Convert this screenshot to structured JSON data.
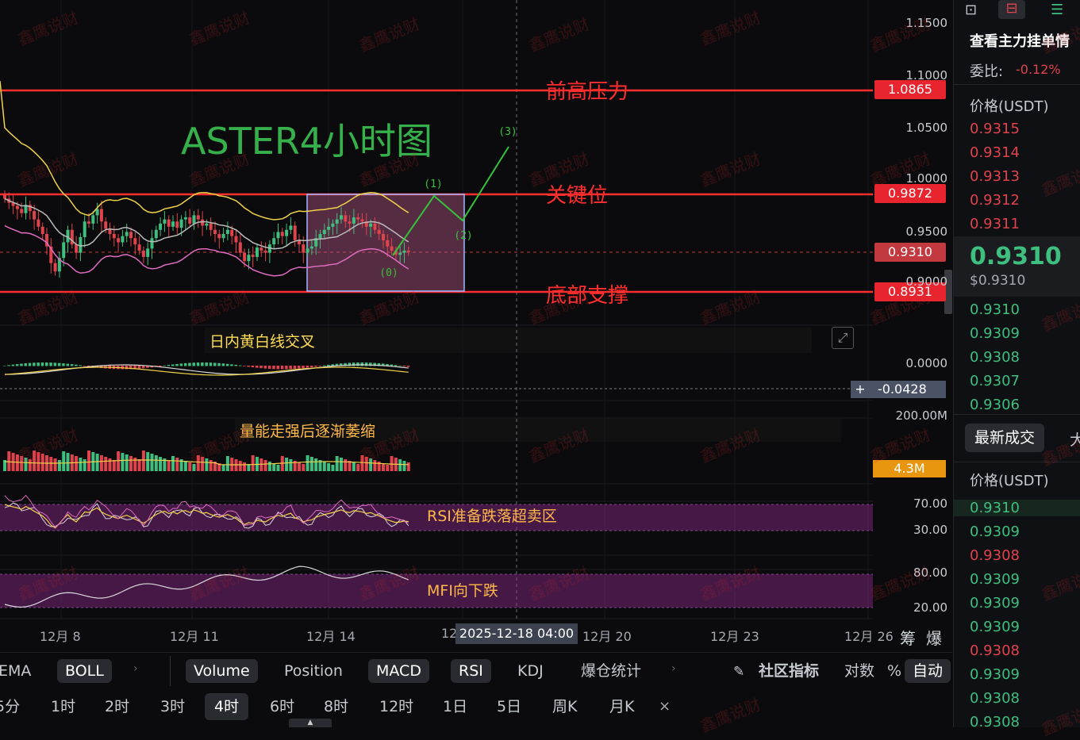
{
  "chart_data": {
    "type": "candlestick",
    "title": "ASTER4小时图",
    "price_axis": {
      "ticks": [
        "1.1500",
        "1.1000",
        "1.0500",
        "1.0000",
        "0.9500",
        "0.9000"
      ],
      "ylim": [
        0.872,
        1.157
      ]
    },
    "x_ticks": [
      "12月 8",
      "12月 11",
      "12月 14",
      "12",
      "12月 20",
      "12月 23",
      "12月 26"
    ],
    "crosshair_date": "2025-12-18 04:00",
    "levels": [
      {
        "name": "前高压力",
        "price": "1.0865",
        "color": "#ff2e2e"
      },
      {
        "name": "关键位",
        "price": "0.9872",
        "color": "#ff2e2e"
      },
      {
        "name": "底部支撑",
        "price": "0.8931",
        "color": "#ff2e2e"
      }
    ],
    "current_price": "0.9310",
    "wave_labels": [
      "(0)",
      "(1)",
      "(2)",
      "(3)"
    ],
    "closes": [
      0.982,
      0.978,
      0.975,
      0.972,
      0.968,
      0.976,
      0.97,
      0.962,
      0.955,
      0.948,
      0.936,
      0.92,
      0.912,
      0.925,
      0.94,
      0.952,
      0.938,
      0.93,
      0.945,
      0.96,
      0.958,
      0.966,
      0.972,
      0.96,
      0.953,
      0.948,
      0.944,
      0.94,
      0.946,
      0.95,
      0.944,
      0.938,
      0.932,
      0.926,
      0.934,
      0.944,
      0.952,
      0.958,
      0.962,
      0.955,
      0.96,
      0.954,
      0.962,
      0.964,
      0.958,
      0.966,
      0.962,
      0.956,
      0.958,
      0.952,
      0.948,
      0.944,
      0.948,
      0.952,
      0.946,
      0.94,
      0.93,
      0.922,
      0.928,
      0.926,
      0.935,
      0.932,
      0.93,
      0.938,
      0.944,
      0.95,
      0.946,
      0.952,
      0.956,
      0.942,
      0.938,
      0.93,
      0.934,
      0.936,
      0.944,
      0.948,
      0.952,
      0.955,
      0.958,
      0.962,
      0.966,
      0.96,
      0.958,
      0.964,
      0.962,
      0.96,
      0.955,
      0.958,
      0.952,
      0.948,
      0.942,
      0.936,
      0.932,
      0.928,
      0.93,
      0.932,
      0.931
    ],
    "annotations": {
      "title": "ASTER4小时图",
      "macd_note": "日内黄白线交叉",
      "volume_note": "量能走强后逐渐萎缩",
      "rsi_note": "RSI准备跌落超卖区",
      "mfi_note": "MFI向下跌"
    },
    "macd": {
      "zero": "0.0000",
      "value": "-0.0428"
    },
    "volume": {
      "max": "200.00M",
      "value": "4.3M"
    },
    "rsi": {
      "upper": "70.00",
      "lower": "30.00"
    },
    "mfi": {
      "upper": "80.00",
      "lower": "20.00"
    }
  },
  "watermark": "鑫鹰说财",
  "toolbar": {
    "indicators": [
      "EMA",
      "BOLL",
      "Volume",
      "Position",
      "MACD",
      "RSI",
      "KDJ",
      "爆仓统计"
    ],
    "active_indicators": [
      "BOLL",
      "Volume",
      "MACD",
      "RSI"
    ],
    "community": "社区指标",
    "log": "对数",
    "percent": "%",
    "auto": "自动",
    "corner_a": "筹",
    "corner_b": "爆"
  },
  "timeframes": [
    "5分",
    "1时",
    "2时",
    "3时",
    "4时",
    "6时",
    "8时",
    "12时",
    "1日",
    "5日",
    "周K",
    "月K"
  ],
  "active_timeframe": "4时",
  "sidebar": {
    "title": "查看主力挂单情",
    "ratio_label": "委比:",
    "ratio_value": "-0.12%",
    "price_header": "价格(USDT)",
    "asks": [
      "0.9315",
      "0.9314",
      "0.9313",
      "0.9312",
      "0.9311"
    ],
    "last_price": "0.9310",
    "last_price_usd": "$0.9310",
    "bids": [
      "0.9310",
      "0.9309",
      "0.9308",
      "0.9307",
      "0.9306"
    ],
    "trades_tab": "最新成交",
    "trades_tab2": "大",
    "trades_header": "价格(USDT)",
    "trades": [
      {
        "p": "0.9310",
        "c": "#3fbf7f"
      },
      {
        "p": "0.9309",
        "c": "#3fbf7f"
      },
      {
        "p": "0.9308",
        "c": "#e0434b"
      },
      {
        "p": "0.9309",
        "c": "#3fbf7f"
      },
      {
        "p": "0.9309",
        "c": "#3fbf7f"
      },
      {
        "p": "0.9309",
        "c": "#3fbf7f"
      },
      {
        "p": "0.9308",
        "c": "#e0434b"
      },
      {
        "p": "0.9309",
        "c": "#3fbf7f"
      },
      {
        "p": "0.9308",
        "c": "#3fbf7f"
      },
      {
        "p": "0.9308",
        "c": "#3fbf7f"
      }
    ]
  }
}
